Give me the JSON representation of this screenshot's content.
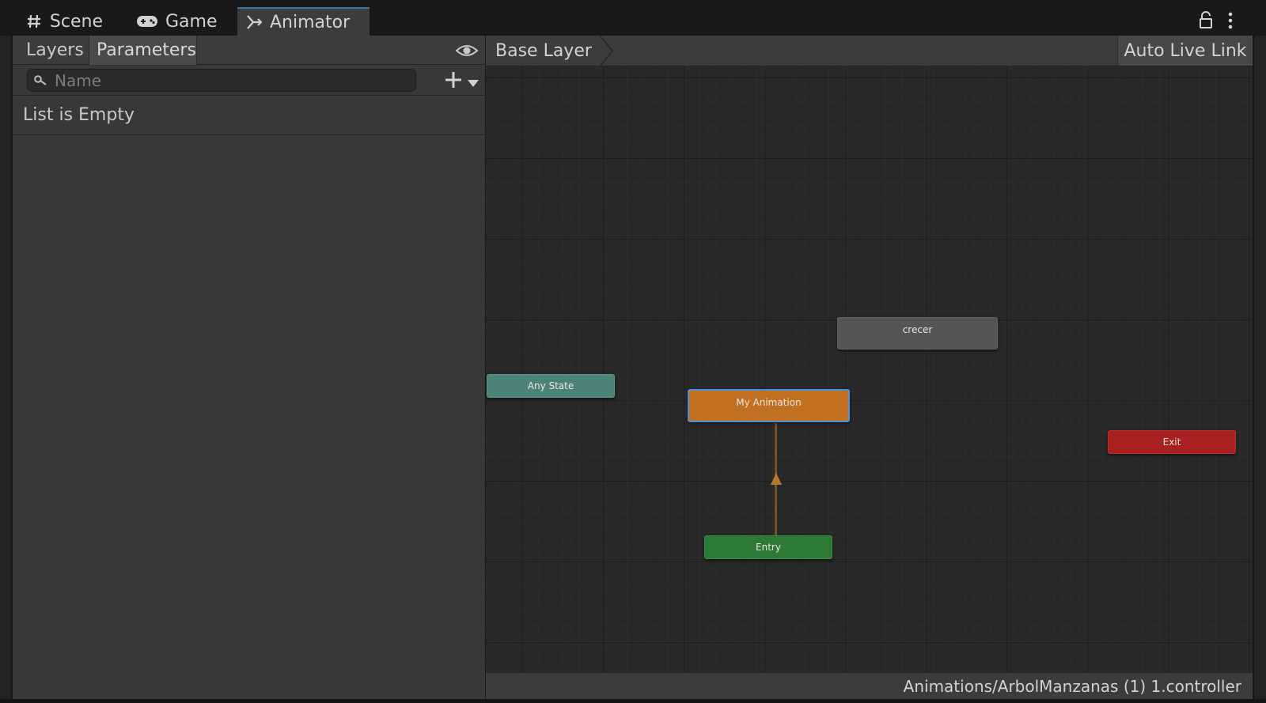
{
  "tabs": [
    {
      "label": "Scene",
      "icon": "hash-icon",
      "active": false
    },
    {
      "label": "Game",
      "icon": "gamepad-icon",
      "active": false
    },
    {
      "label": "Animator",
      "icon": "animator-icon",
      "active": true
    }
  ],
  "window_icons": [
    "lock-icon",
    "kebab-menu-icon"
  ],
  "left_panel": {
    "tabs": [
      {
        "label": "Layers",
        "active": false
      },
      {
        "label": "Parameters",
        "active": true
      }
    ],
    "eye_icon": "eye-icon",
    "search": {
      "placeholder": "Name",
      "value": ""
    },
    "add_icon": "plus-icon",
    "empty_message": "List is Empty"
  },
  "graph": {
    "breadcrumb": "Base Layer",
    "auto_live_link_label": "Auto Live Link",
    "nodes": {
      "any_state": "Any State",
      "crecer": "crecer",
      "my_animation": "My Animation",
      "exit": "Exit",
      "entry": "Entry"
    },
    "node_colors": {
      "any_state": "#4d8278",
      "crecer": "#555558",
      "my_animation": "#c0701e",
      "exit": "#a92021",
      "entry": "#2d7a36",
      "selection": "#4c8fe0",
      "transition": "#7a5420"
    },
    "status_path": "Animations/ArbolManzanas (1) 1.controller"
  }
}
